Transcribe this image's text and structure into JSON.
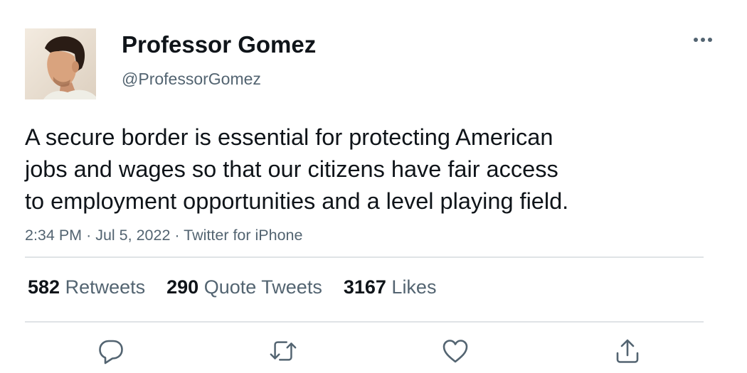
{
  "author": {
    "display_name": "Professor Gomez",
    "handle": "@ProfessorGomez"
  },
  "tweet": {
    "text": "A secure border is essential for protecting American\njobs and wages so that our citizens have fair access\nto employment opportunities and a level playing field.",
    "time": "2:34 PM",
    "date": "Jul 5, 2022",
    "source": "Twitter for iPhone",
    "separator": "·"
  },
  "stats": {
    "retweets_count": "582",
    "retweets_label": "Retweets",
    "quote_tweets_count": "290",
    "quote_tweets_label": "Quote Tweets",
    "likes_count": "3167",
    "likes_label": "Likes"
  },
  "actions": {
    "reply_icon": "speech-bubble-icon",
    "retweet_icon": "retweet-icon",
    "like_icon": "heart-icon",
    "share_icon": "share-icon",
    "more_icon": "three-dots-icon"
  },
  "colors": {
    "text_primary": "#0f1419",
    "text_secondary": "#536471",
    "divider": "#dfe3e6"
  }
}
